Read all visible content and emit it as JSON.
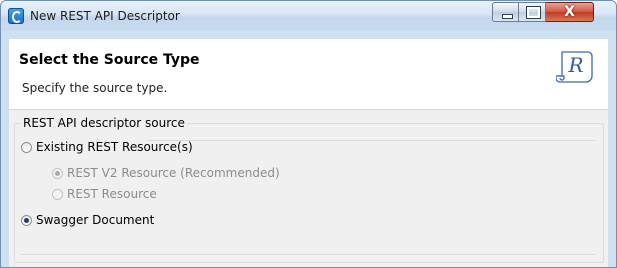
{
  "window": {
    "title": "New REST API Descriptor",
    "close_glyph": "X"
  },
  "header": {
    "title": "Select the Source Type",
    "description": "Specify the source type.",
    "icon_letter": "R"
  },
  "group": {
    "legend": "REST API descriptor source",
    "options": [
      {
        "label": "Existing REST Resource(s)",
        "checked": false,
        "enabled": true
      },
      {
        "label": "REST V2 Resource (Recommended)",
        "checked": true,
        "enabled": false
      },
      {
        "label": "REST Resource",
        "checked": false,
        "enabled": false
      },
      {
        "label": "Swagger Document",
        "checked": true,
        "enabled": true
      }
    ]
  }
}
